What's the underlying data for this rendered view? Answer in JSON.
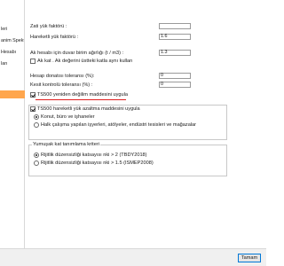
{
  "left_panel": {
    "items": [
      "leri",
      "anim Spekt...",
      "Hesabı",
      "ları"
    ]
  },
  "fields": {
    "zati_label": "Zati yük faktörü :",
    "zati_value": "",
    "hareketli_label": "Hareketli yük faktörü :",
    "hareketli_value": "1.6",
    "ak_label": "Ak hesabı için duvar birim ağırlığı (t / m3) :",
    "ak_value": "1.3",
    "ak_kat_label": "Ak kat . Ak değerini üstteki katla aynı kullan",
    "hesap_label": "Hesap donatısı toleransı (%):",
    "hesap_value": "0",
    "kesit_label": "Kesit kontrolü toleransı (%) :",
    "kesit_value": "0",
    "ts500_label": "TS500 yeniden değilim maddesini uygula"
  },
  "group1": {
    "title": "TS500 hareketli yük azaltma maddesini uygula",
    "radio1": "Konut, büro ve işhaneler",
    "radio2": "Halk çalışma yapılan işyerleri, atölyeler, endüstri tesisleri ve mağazalar"
  },
  "group2": {
    "title": "Yumuşak kat tanımlama kriteri",
    "radio1": "Rijitlik düzensizliği katsayısı nki > 2 (TBDY2018)",
    "radio2": "Rijitlik düzensizliği katsayısı nki > 1.5 (ISMEP2008)"
  },
  "footer": {
    "ok_label": "Tamam"
  }
}
